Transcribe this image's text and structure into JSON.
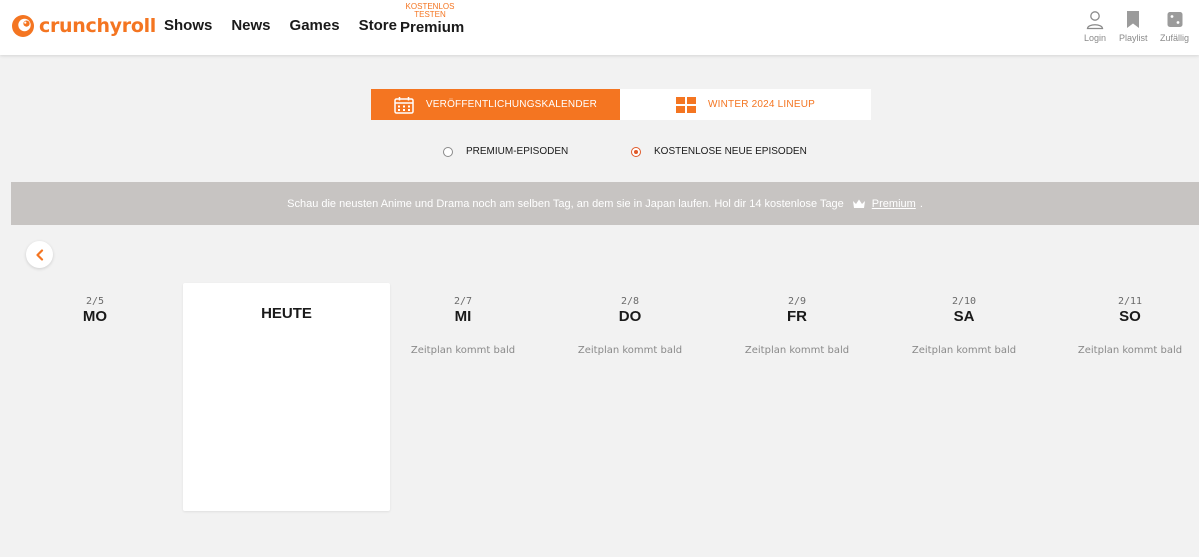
{
  "header": {
    "logo_text": "crunchyroll",
    "nav": [
      {
        "label": "Shows"
      },
      {
        "label": "News"
      },
      {
        "label": "Games"
      },
      {
        "label": "Store"
      }
    ],
    "premium": {
      "badge_line1": "KOSTENLOS",
      "badge_line2": "TESTEN",
      "label": "Premium"
    },
    "actions": [
      {
        "label": "Login",
        "icon": "user-icon"
      },
      {
        "label": "Playlist",
        "icon": "bookmark-icon"
      },
      {
        "label": "Zufällig",
        "icon": "dice-icon"
      }
    ]
  },
  "tabs": [
    {
      "label": "VERÖFFENTLICHUNGSKALENDER",
      "icon": "calendar-icon",
      "active": true
    },
    {
      "label": "WINTER 2024 LINEUP",
      "icon": "grid-icon",
      "active": false
    }
  ],
  "filters": [
    {
      "label": "PREMIUM-EPISODEN",
      "selected": false
    },
    {
      "label": "KOSTENLOSE NEUE EPISODEN",
      "selected": true
    }
  ],
  "banner": {
    "text": "Schau die neusten Anime und Drama noch am selben Tag, an dem sie in Japan laufen. Hol dir 14 kostenlose Tage",
    "link": "Premium",
    "suffix": "."
  },
  "schedule": {
    "today_label": "HEUTE",
    "days": [
      {
        "date": "2/5",
        "name": "MO",
        "status": ""
      },
      {
        "date": "2/7",
        "name": "MI",
        "status": "Zeitplan kommt bald"
      },
      {
        "date": "2/8",
        "name": "DO",
        "status": "Zeitplan kommt bald"
      },
      {
        "date": "2/9",
        "name": "FR",
        "status": "Zeitplan kommt bald"
      },
      {
        "date": "2/10",
        "name": "SA",
        "status": "Zeitplan kommt bald"
      },
      {
        "date": "2/11",
        "name": "SO",
        "status": "Zeitplan kommt bald"
      }
    ]
  },
  "colors": {
    "accent": "#f47521",
    "background": "#f2f2f2",
    "banner": "#c7c4c2",
    "radio_selected": "#e05a2a"
  }
}
